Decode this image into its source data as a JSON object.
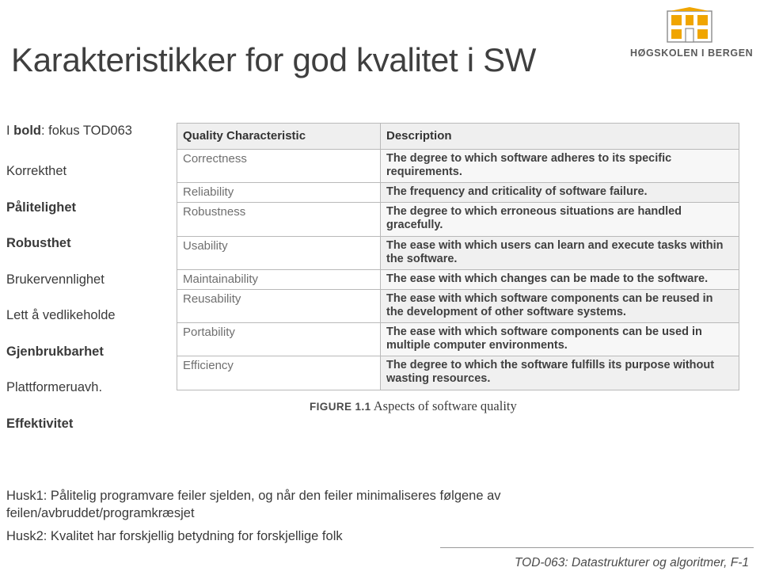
{
  "logo": {
    "icon": "hib-building-logo-icon",
    "text": "HØGSKOLEN I BERGEN",
    "brand_color": "#f0a500"
  },
  "slide": {
    "title": "Karakteristikker for god kvalitet i SW"
  },
  "left_column": {
    "legend": "I bold: fokus TOD063",
    "legend_bold_part": "bold",
    "items": [
      {
        "label": "Korrekthet",
        "bold": false
      },
      {
        "label": "Pålitelighet",
        "bold": true
      },
      {
        "label": "Robusthet",
        "bold": true
      },
      {
        "label": "Brukervennlighet",
        "bold": false
      },
      {
        "label": "Lett å vedlikeholde",
        "bold": false
      },
      {
        "label": "Gjenbrukbarhet",
        "bold": true
      },
      {
        "label": "Plattformeruavh.",
        "bold": false
      },
      {
        "label": "Effektivitet",
        "bold": true
      }
    ]
  },
  "table": {
    "headers": [
      "Quality Characteristic",
      "Description"
    ],
    "rows": [
      {
        "characteristic": "Correctness",
        "description": "The degree to which software adheres to its specific requirements."
      },
      {
        "characteristic": "Reliability",
        "description": "The frequency and criticality of software failure."
      },
      {
        "characteristic": "Robustness",
        "description": "The degree to which erroneous situations are handled gracefully."
      },
      {
        "characteristic": "Usability",
        "description": "The ease with which users can learn and execute tasks within the software."
      },
      {
        "characteristic": "Maintainability",
        "description": "The ease with which changes can be made to the software."
      },
      {
        "characteristic": "Reusability",
        "description": "The ease with which software components can be reused in the development of other software systems."
      },
      {
        "characteristic": "Portability",
        "description": "The ease with which software components can be used in multiple computer environments."
      },
      {
        "characteristic": "Efficiency",
        "description": "The degree to which the software fulfills its purpose without wasting resources."
      }
    ],
    "caption_number": "FIGURE 1.1",
    "caption_text": "Aspects of software quality"
  },
  "notes": [
    "Husk1: Pålitelig programvare feiler sjelden, og når den feiler minimaliseres følgene av feilen/avbruddet/programkræsjet",
    "Husk2: Kvalitet har forskjellig betydning for forskjellige folk"
  ],
  "footer": {
    "text": "TOD-063: Datastrukturer og algoritmer, F-1"
  }
}
